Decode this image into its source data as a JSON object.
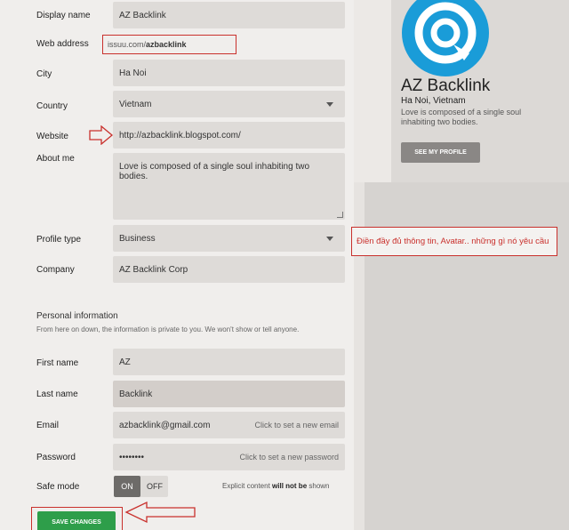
{
  "form": {
    "display_name": {
      "label": "Display name",
      "value": "AZ Backlink"
    },
    "web_address": {
      "label": "Web address",
      "prefix": "issuu.com/",
      "value": "azbacklink"
    },
    "city": {
      "label": "City",
      "value": "Ha Noi"
    },
    "country": {
      "label": "Country",
      "value": "Vietnam"
    },
    "website": {
      "label": "Website",
      "value": "http://azbacklink.blogspot.com/"
    },
    "about_me": {
      "label": "About me",
      "value": "Love is composed of a single soul inhabiting two bodies."
    },
    "profile_type": {
      "label": "Profile type",
      "value": "Business"
    },
    "company": {
      "label": "Company",
      "value": "AZ Backlink Corp"
    }
  },
  "personal": {
    "title": "Personal information",
    "subtitle": "From here on down, the information is private to you. We won't show or tell anyone.",
    "first_name": {
      "label": "First name",
      "value": "AZ"
    },
    "last_name": {
      "label": "Last name",
      "value": "Backlink"
    },
    "email": {
      "label": "Email",
      "value": "azbacklink@gmail.com",
      "hint": "Click to set a new email"
    },
    "password": {
      "label": "Password",
      "value": "••••••••",
      "hint": "Click to set a new password"
    },
    "safe_mode": {
      "label": "Safe mode",
      "on": "ON",
      "off": "OFF",
      "note_pre": "Explicit content ",
      "note_bold": "will not be",
      "note_post": " shown"
    }
  },
  "save_label": "SAVE CHANGES",
  "profile": {
    "name": "AZ Backlink",
    "location": "Ha Noi, Vietnam",
    "bio": "Love is composed of a single soul inhabiting two bodies.",
    "see_profile": "SEE MY PROFILE"
  },
  "annotation_note": "Điền đầy đủ thông tin, Avatar.. những gì nó yêu cầu",
  "colors": {
    "accent_green": "#2e9e4a",
    "annotation_red": "#c9302c",
    "logo_blue": "#1a9cd8"
  }
}
